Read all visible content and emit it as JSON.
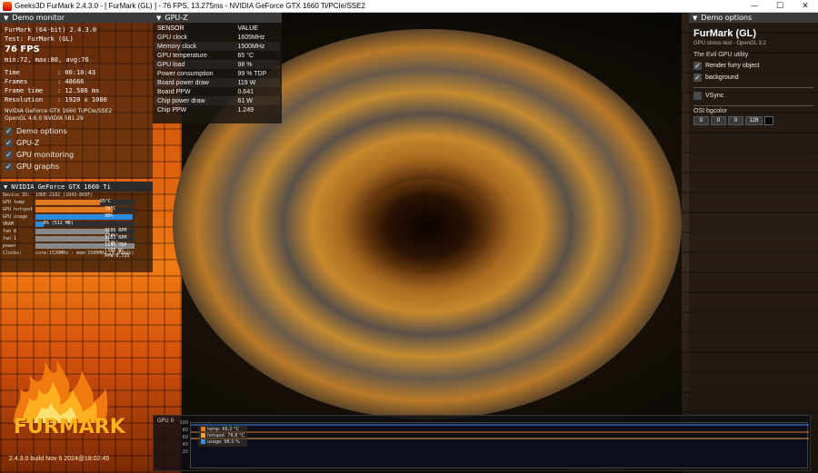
{
  "window": {
    "title": "Geeks3D FurMark 2.4.3.0 - [ FurMark (GL) ] - 76 FPS, 13.275ms - NVIDIA GeForce GTX 1660 Ti/PCIe/SSE2",
    "minimize": "—",
    "maximize": "☐",
    "close": "✕"
  },
  "demo_monitor": {
    "header": "Demo monitor",
    "app_line": "FurMark (64-bit) 2.4.3.0",
    "test_line": "Test: FurMark (GL)",
    "fps": "76 FPS",
    "fps_stats": "min:72, max:80, avg:76",
    "time_label": "Time",
    "time_value": ": 00:10:43",
    "frames_label": "Frames",
    "frames_value": ": 48666",
    "frametime_label": "Frame time",
    "frametime_value": ": 12.586 ms",
    "resolution_label": "Resolution",
    "resolution_value": ": 1920 x 1080",
    "renderer": "NVIDIA GeForce GTX 1660 Ti/PCIe/SSE2",
    "opengl": "OpenGL 4.6.0 NVIDIA 581.29",
    "checks": [
      {
        "label": "Demo options",
        "checked": true
      },
      {
        "label": "GPU-Z",
        "checked": true
      },
      {
        "label": "GPU monitoring",
        "checked": true
      },
      {
        "label": "GPU graphs",
        "checked": true
      }
    ]
  },
  "gpu_monitor": {
    "header": "NVIDIA GeForce GTX 1660 Ti",
    "device_id_label": "Device ID:",
    "device_id": "10DE-2182 (1043-869F)",
    "rows": [
      {
        "label": "GPU temp",
        "value": "65°C",
        "fraction": 0.65,
        "color": "#e07820"
      },
      {
        "label": "GPU hotspot",
        "value": "78°C",
        "fraction": 0.78,
        "color": "#e07820"
      },
      {
        "label": "GPU usage",
        "value": "98%",
        "fraction": 0.98,
        "color": "#2a8ae0"
      },
      {
        "label": "VRAM",
        "value": "8% (512 MB)",
        "fraction": 0.08,
        "color": "#2a8ae0"
      },
      {
        "label": "fan 0",
        "value": "3186 RPM (74%)",
        "fraction": 0.74,
        "color": "#888"
      },
      {
        "label": "fan 1",
        "value": "3183 RPM (74%)",
        "fraction": 0.74,
        "color": "#888"
      },
      {
        "label": "power",
        "value": "114% TDP (105 W) - PPW:0.723",
        "fraction": 1.0,
        "color": "#888"
      }
    ],
    "clocks_label": "Clocks:",
    "clocks_value": "core:1530MHz - mem:1500MHz (6.0Gbps)"
  },
  "gpuz": {
    "header": "GPU-Z",
    "col_sensor": "SENSOR",
    "col_value": "VALUE",
    "rows": [
      {
        "sensor": "GPU clock",
        "value": "1605MHz"
      },
      {
        "sensor": "Memory clock",
        "value": "1500MHz"
      },
      {
        "sensor": "GPU temperature",
        "value": "65 °C"
      },
      {
        "sensor": "GPU load",
        "value": "98 %"
      },
      {
        "sensor": "Power consumption",
        "value": "99 % TDP"
      },
      {
        "sensor": "Board power draw",
        "value": "119 W"
      },
      {
        "sensor": "Board PPW",
        "value": "0.641"
      },
      {
        "sensor": "Chip power draw",
        "value": "61 W"
      },
      {
        "sensor": "Chip PPW",
        "value": "1.249"
      }
    ]
  },
  "demo_options": {
    "header": "Demo options",
    "title": "FurMark (GL)",
    "subtitle": "GPU stress test - OpenGL 3.2",
    "section": "The Evil GPU utility",
    "render_furry": "Render furry object",
    "background": "background",
    "vsync": "VSync",
    "osi_label": "OSI bgcolor",
    "rgba": [
      "0",
      "0",
      "0",
      "128"
    ]
  },
  "graph": {
    "label": "GPU 0",
    "ticks": [
      "100",
      "80",
      "60",
      "40",
      "20"
    ],
    "legend": [
      {
        "label": "temp: 66.2 °C",
        "color": "#e07820"
      },
      {
        "label": "hotspot: 78.8 °C",
        "color": "#f0a040"
      },
      {
        "label": "usage: 98.0 %",
        "color": "#3a8ae0"
      }
    ]
  },
  "logo": {
    "word": "FURMARK",
    "build": "2.4.3.0 build Nov  6 2024@18:02:45"
  },
  "icons": {
    "check": "✓",
    "triangle": "▼"
  }
}
